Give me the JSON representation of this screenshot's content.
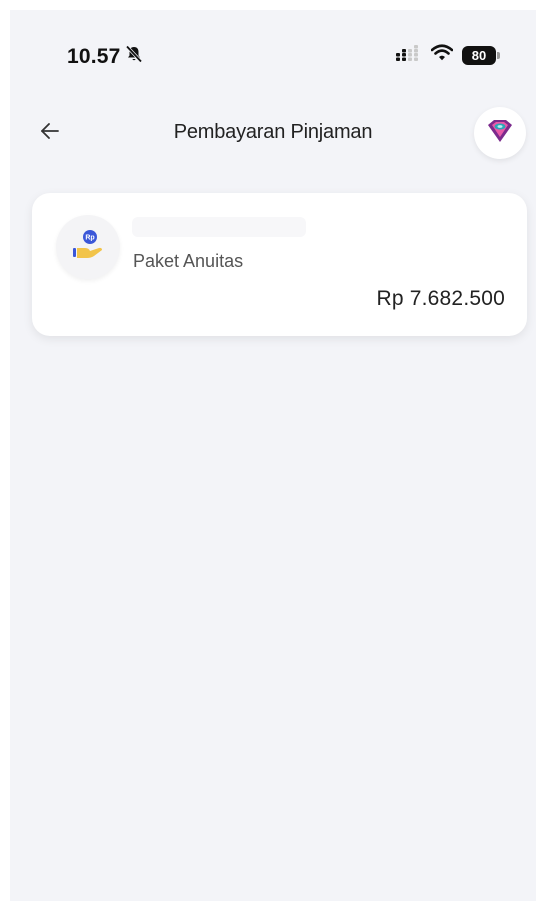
{
  "status_bar": {
    "time": "10.57",
    "battery": "80",
    "icons": [
      "mute-bell-icon",
      "signal-icon",
      "wifi-icon",
      "battery-icon"
    ]
  },
  "header": {
    "title": "Pembayaran Pinjaman",
    "back_icon": "arrow-left-icon",
    "logo_icon": "brand-logo-icon"
  },
  "loan_card": {
    "type": "Paket Anuitas",
    "amount": "Rp 7.682.500",
    "icon": "hand-coin-icon",
    "icon_badge": "Rp"
  },
  "colors": {
    "background": "#f3f4f8",
    "card": "#ffffff",
    "coin_blue": "#3b57d8",
    "hand_yellow": "#f2c44a",
    "logo_purple": "#7b2a8c",
    "logo_teal": "#2aa7b7"
  }
}
